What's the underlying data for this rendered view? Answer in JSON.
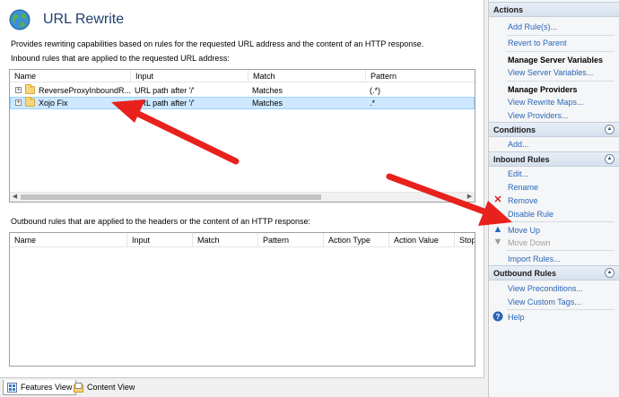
{
  "header": {
    "title": "URL Rewrite"
  },
  "description": "Provides rewriting capabilities based on rules for the requested URL address and the content of an HTTP response.",
  "inbound": {
    "caption": "Inbound rules that are applied to the requested URL address:",
    "columns": [
      "Name",
      "Input",
      "Match",
      "Pattern"
    ],
    "rows": [
      {
        "name": "ReverseProxyInboundR...",
        "input": "URL path after '/'",
        "match": "Matches",
        "pattern": "(.*)"
      },
      {
        "name": "Xojo Fix",
        "input": "URL path after '/'",
        "match": "Matches",
        "pattern": ".*"
      }
    ]
  },
  "outbound": {
    "caption": "Outbound rules that are applied to the headers or the content of an HTTP response:",
    "columns": [
      "Name",
      "Input",
      "Match",
      "Pattern",
      "Action Type",
      "Action Value",
      "Stop"
    ]
  },
  "tabs": {
    "features": "Features View",
    "content": "Content View"
  },
  "actions": {
    "title": "Actions",
    "add_rules": "Add Rule(s)...",
    "revert": "Revert to Parent",
    "manage_server_vars": "Manage Server Variables",
    "view_server_vars": "View Server Variables...",
    "manage_providers": "Manage Providers",
    "view_rewrite_maps": "View Rewrite Maps...",
    "view_providers": "View Providers...",
    "conditions_title": "Conditions",
    "cond_add": "Add...",
    "inbound_title": "Inbound Rules",
    "edit": "Edit...",
    "rename": "Rename",
    "remove": "Remove",
    "disable": "Disable Rule",
    "move_up": "Move Up",
    "move_down": "Move Down",
    "import": "Import Rules...",
    "outbound_title": "Outbound Rules",
    "view_preconditions": "View Preconditions...",
    "view_custom_tags": "View Custom Tags...",
    "help": "Help"
  },
  "icons": {
    "globe": "globe-icon",
    "folder": "folder-icon",
    "remove": "red-x-icon",
    "move_up": "blue-up-arrow-icon",
    "move_down": "gray-down-arrow-icon",
    "help": "help-icon",
    "collapse": "chevron-up-icon"
  },
  "colors": {
    "arrow": "#e8211d",
    "link": "#2a66b8",
    "selected_row": "#cde8ff"
  }
}
